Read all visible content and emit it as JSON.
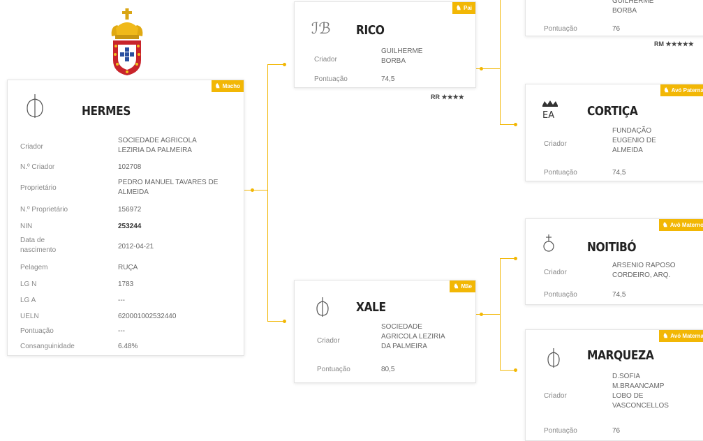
{
  "main": {
    "name": "HERMES",
    "badge": "Macho",
    "fields": [
      {
        "label": "Criador",
        "value": "SOCIEDADE AGRICOLA LEZIRIA DA PALMEIRA"
      },
      {
        "label": "N.º Criador",
        "value": "102708"
      },
      {
        "label": "Proprietário",
        "value": "PEDRO MANUEL TAVARES DE ALMEIDA"
      },
      {
        "label": "N.º Proprietário",
        "value": "156972"
      },
      {
        "label": "NIN",
        "value": "253244"
      },
      {
        "label": "Data de nascimento",
        "value": "2012-04-21"
      },
      {
        "label": "Pelagem",
        "value": "RUÇA"
      },
      {
        "label": "LG N",
        "value": "1783"
      },
      {
        "label": "LG A",
        "value": "---"
      },
      {
        "label": "UELN",
        "value": "620001002532440"
      },
      {
        "label": "Pontuação",
        "value": "---"
      },
      {
        "label": "Consanguinidade",
        "value": "6.48%"
      }
    ]
  },
  "sire": {
    "name": "RICO",
    "badge": "Pai",
    "criador_label": "Criador",
    "criador": "GUILHERME BORBA",
    "pontuacao_label": "Pontuação",
    "pontuacao": "74,5",
    "rating": "RR ★★★★"
  },
  "dam": {
    "name": "XALE",
    "badge": "Mãe",
    "criador_label": "Criador",
    "criador": "SOCIEDADE AGRICOLA LEZIRIA DA PALMEIRA",
    "pontuacao_label": "Pontuação",
    "pontuacao": "80,5"
  },
  "grandsire_top": {
    "criador_partial": "GUILHERME BORBA",
    "pontuacao_label": "Pontuação",
    "pontuacao": "76",
    "rating": "RM ★★★★★"
  },
  "paternal_granddam": {
    "name": "CORTIÇA",
    "badge": "Avó Paterna",
    "criador_label": "Criador",
    "criador": "FUNDAÇÃO EUGENIO DE ALMEIDA",
    "pontuacao_label": "Pontuação",
    "pontuacao": "74,5"
  },
  "maternal_grandsire": {
    "name": "NOITIBÓ",
    "badge": "Avô Materno",
    "criador_label": "Criador",
    "criador": "ARSENIO RAPOSO CORDEIRO, ARQ.",
    "pontuacao_label": "Pontuação",
    "pontuacao": "74,5"
  },
  "maternal_granddam": {
    "name": "MARQUEZA",
    "badge": "Avó Materna",
    "criador_label": "Criador",
    "criador": "D.SOFIA M.BRAANCAMP LOBO DE VASCONCELLOS",
    "pontuacao_label": "Pontuação",
    "pontuacao": "76"
  },
  "colors": {
    "accent": "#f2b705",
    "name": "#222222",
    "label": "#888888"
  },
  "icons": {
    "badge": "horse-icon",
    "brand": "brand-mark-icon",
    "crest": "coat-of-arms-icon"
  }
}
